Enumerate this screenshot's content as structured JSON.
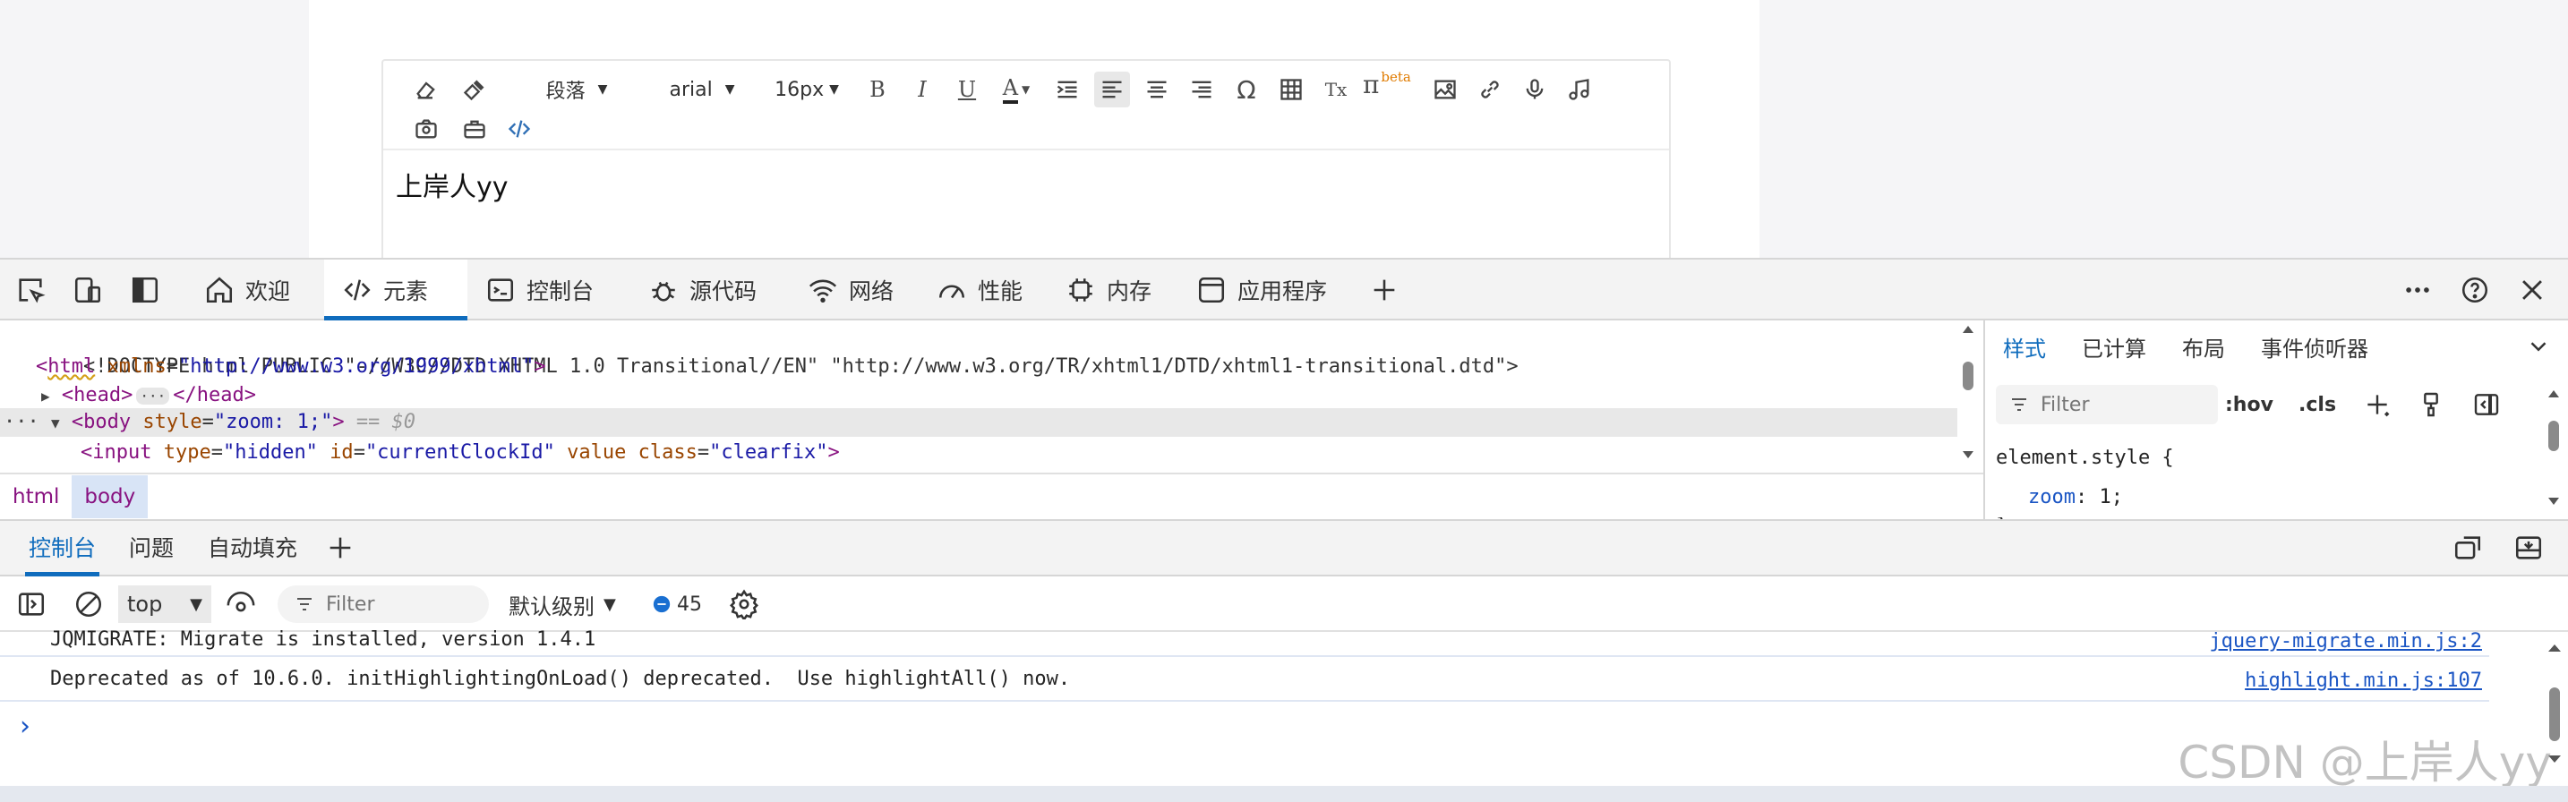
{
  "editor": {
    "toolbar": {
      "paragraph": "段落",
      "font": "arial",
      "size": "16px",
      "bold": "B",
      "italic": "I",
      "underline": "U",
      "font_color": "A",
      "special_char": "Ω",
      "clear_format": "Tx",
      "formula": "π",
      "formula_badge": "beta"
    },
    "content": "上岸人yy"
  },
  "devtools": {
    "tabs": [
      {
        "label": "欢迎"
      },
      {
        "label": "元素"
      },
      {
        "label": "控制台"
      },
      {
        "label": "源代码"
      },
      {
        "label": "网络"
      },
      {
        "label": "性能"
      },
      {
        "label": "内存"
      },
      {
        "label": "应用程序"
      }
    ],
    "active_tab": "元素",
    "accent_color": "#0f6cbd"
  },
  "elements": {
    "doctype": "<!DOCTYPE html PUBLIC \"-//W3C//DTD XHTML 1.0 Transitional//EN\" \"http://www.w3.org/TR/xhtml1/DTD/xhtml1-transitional.dtd\">",
    "html_tag": "html",
    "html_attr": "xmlns",
    "html_val": "\"http://www.w3.org/1999/xhtml\"",
    "head_open": "<head>",
    "head_close": "</head>",
    "ellipsis": "···",
    "body_tag": "<body",
    "body_attr": "style",
    "body_val": "\"zoom: 1;\"",
    "body_suffix": "== $0",
    "input_tag": "<input",
    "input_attr1": "type",
    "input_val1": "\"hidden\"",
    "input_attr2": "id",
    "input_val2": "\"currentClockId\"",
    "input_attr3": "value",
    "input_attr4": "class",
    "input_val4": "\"clearfix\"",
    "breadcrumbs": [
      "html",
      "body"
    ]
  },
  "styles": {
    "tabs": [
      "样式",
      "已计算",
      "布局",
      "事件侦听器"
    ],
    "filter_placeholder": "Filter",
    "hov": ":hov",
    "cls": ".cls",
    "rule_selector": "element.style {",
    "rule_prop": "zoom",
    "rule_value": "1;",
    "rule_close": "}"
  },
  "drawer": {
    "tabs": [
      "控制台",
      "问题",
      "自动填充"
    ]
  },
  "console": {
    "context": "top",
    "filter_placeholder": "Filter",
    "level": "默认级别",
    "message_count": "45",
    "messages": [
      {
        "text": "JQMIGRATE: Migrate is installed, version 1.4.1",
        "source": "jquery-migrate.min.js:2"
      },
      {
        "text": "Deprecated as of 10.6.0. initHighlightingOnLoad() deprecated.  Use highlightAll() now.",
        "source": "highlight.min.js:107"
      }
    ],
    "prompt": "›"
  },
  "watermark": "CSDN @上岸人yy"
}
